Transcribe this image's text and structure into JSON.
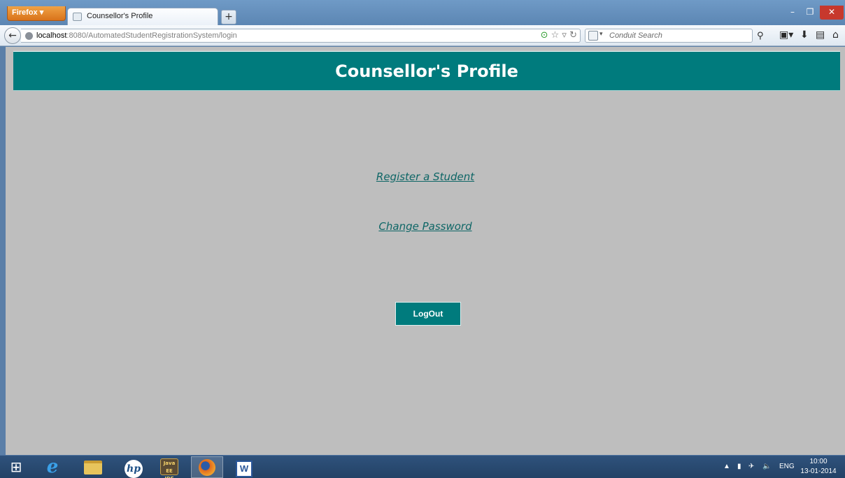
{
  "browser": {
    "app_button": "Firefox",
    "tab_title": "Counsellor's Profile",
    "new_tab": "+",
    "url_host": "localhost",
    "url_rest": ":8080/AutomatedStudentRegistrationSystem/login",
    "search_placeholder": "Conduit Search"
  },
  "page": {
    "title": "Counsellor's Profile",
    "links": {
      "register": "Register a Student",
      "change_password": "Change Password"
    },
    "logout_label": "LogOut",
    "colors": {
      "header_bg": "#007b7d",
      "page_bg": "#bebebe",
      "link": "#0e6666"
    }
  },
  "taskbar": {
    "apps": [
      "start-icon",
      "internet-explorer-icon",
      "file-explorer-icon",
      "hp-icon",
      "java-ee-ide-icon",
      "firefox-icon",
      "word-icon"
    ],
    "java_label": "Java EE IDE",
    "tray": {
      "language": "ENG",
      "time": "10:00",
      "date": "13-01-2014"
    }
  }
}
